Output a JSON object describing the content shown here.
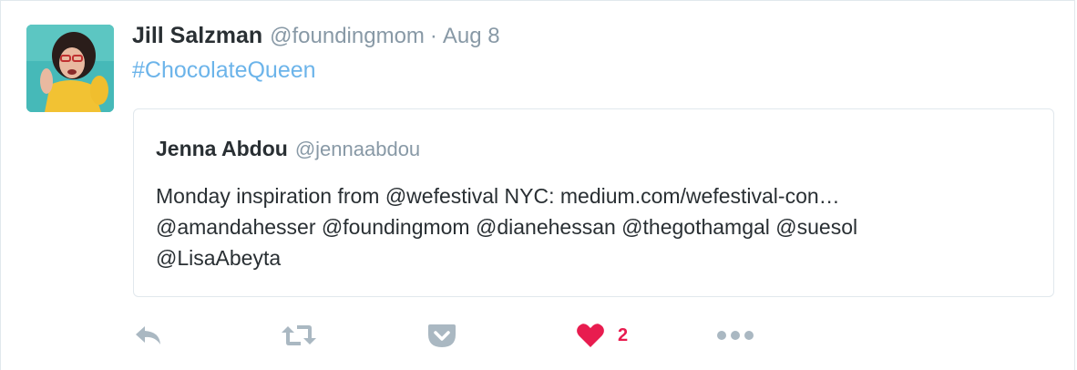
{
  "tweet": {
    "author_name": "Jill Salzman",
    "author_handle": "@foundingmom",
    "separator": "·",
    "timestamp": "Aug 8",
    "text": "#ChocolateQueen"
  },
  "quoted_tweet": {
    "author_name": "Jenna Abdou",
    "author_handle": "@jennaabdou",
    "text_lines": [
      "Monday inspiration from @wefestival NYC: medium.com/wefestival-con…",
      "@amandahesser @foundingmom @dianehessan @thegothamgal @suesol",
      "@LisaAbeyta"
    ]
  },
  "actions": {
    "reply_icon": "reply-icon",
    "retweet_icon": "retweet-icon",
    "pocket_icon": "pocket-icon",
    "like_icon": "heart-icon",
    "like_count": "2",
    "more_icon": "more-dots-icon"
  },
  "colors": {
    "name": "#292f33",
    "meta": "#8899a6",
    "hashtag": "#6cb4ea",
    "action_icon": "#aab8c2",
    "liked": "#e81c4f",
    "border": "#e1e8ed"
  }
}
